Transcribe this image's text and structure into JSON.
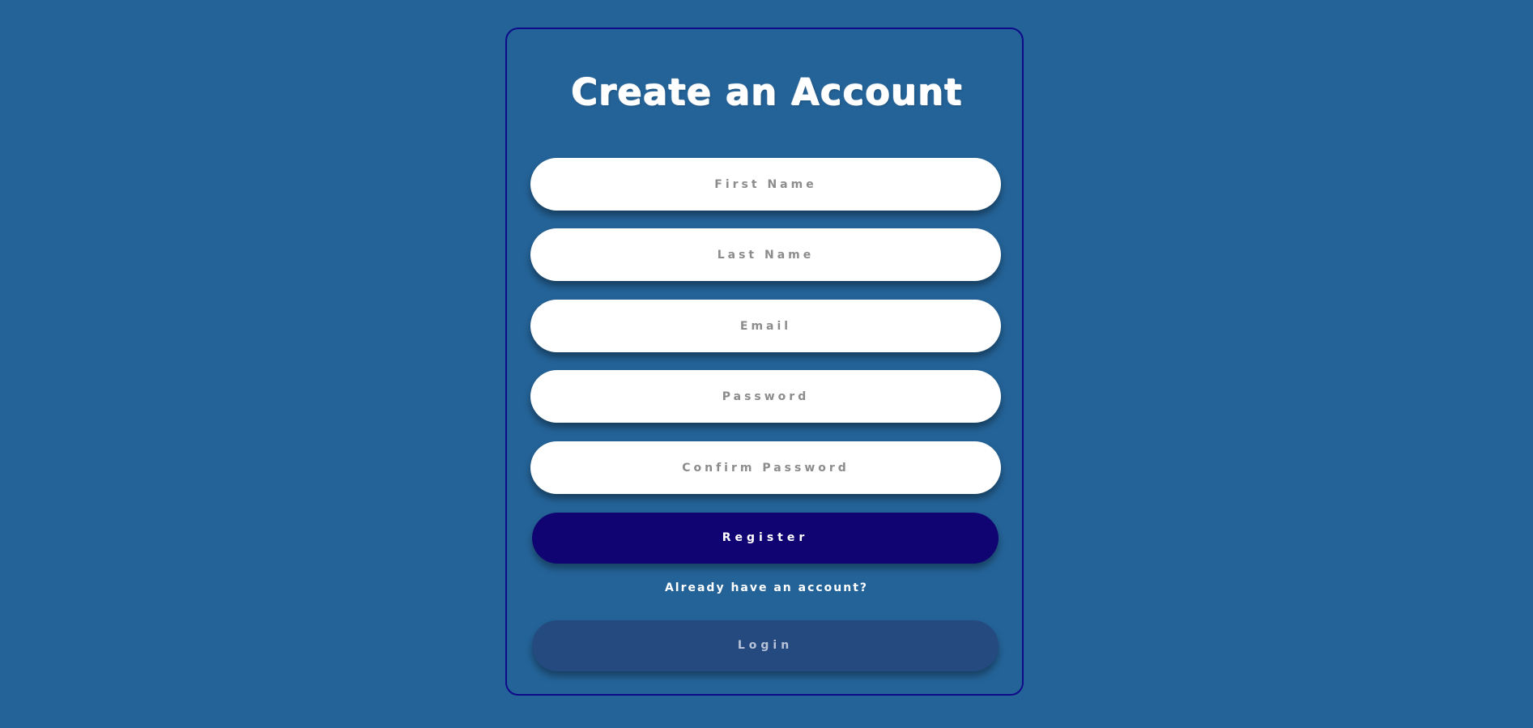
{
  "form": {
    "title": "Create an Account",
    "fields": {
      "first_name": {
        "value": "",
        "placeholder": "First Name"
      },
      "last_name": {
        "value": "",
        "placeholder": "Last Name"
      },
      "email": {
        "value": "",
        "placeholder": "Email"
      },
      "password": {
        "value": "",
        "placeholder": "Password"
      },
      "confirm_password": {
        "value": "",
        "placeholder": "Confirm Password"
      }
    },
    "register_label": "Register",
    "already_text": "Already have an account?",
    "login_label": "Login"
  },
  "colors": {
    "background": "#246398",
    "card_border": "#0f0a8a",
    "register_button": "#100472",
    "login_button": "#244a80",
    "input_background": "#ffffff",
    "placeholder_text": "#8c8c8c"
  }
}
